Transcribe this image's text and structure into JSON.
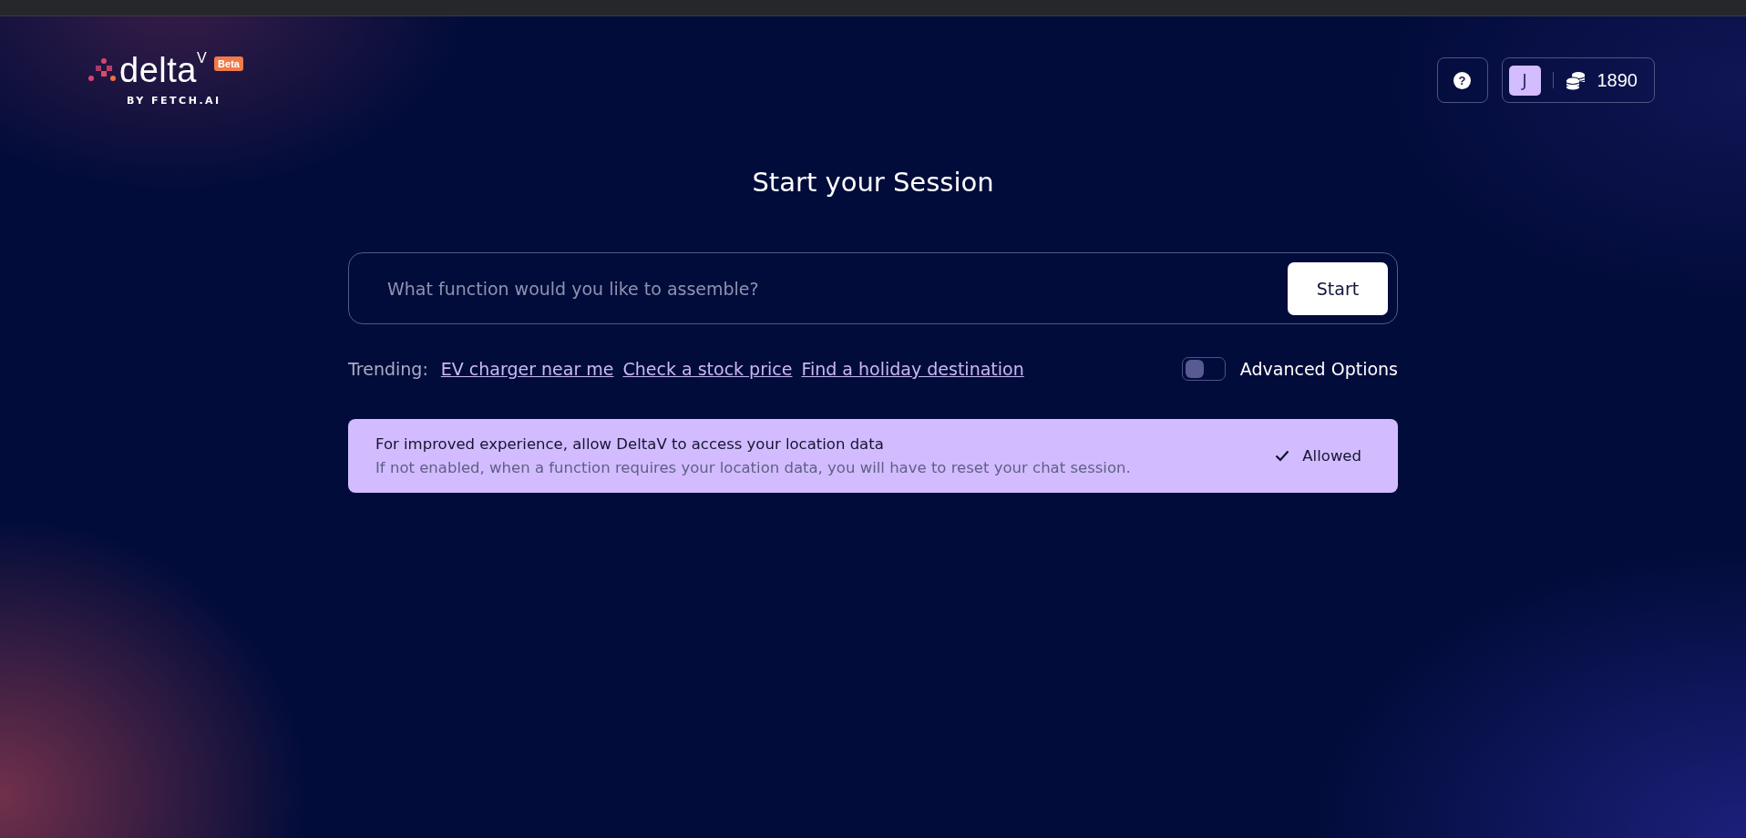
{
  "header": {
    "logo": {
      "name": "delta",
      "mark": "V",
      "badge": "Beta",
      "tagline": "BY FETCH.AI"
    },
    "help_button": {
      "label": "?"
    },
    "account": {
      "avatar": "J",
      "credits": "1890"
    }
  },
  "session": {
    "title": "Start your Session",
    "prompt": {
      "placeholder": "What function would you like to assemble?",
      "button": "Start"
    },
    "trending": {
      "label": "Trending:",
      "links": [
        "EV charger near me",
        "Check a stock price",
        "Find a holiday destination"
      ]
    },
    "advanced_options": {
      "label": "Advanced Options",
      "on": false
    },
    "location_banner": {
      "title": "For improved experience, allow DeltaV to access your location data",
      "text": "If not enabled, when a function requires your location data, you will have to reset your chat session.",
      "status": "Allowed",
      "allowed": true
    }
  }
}
